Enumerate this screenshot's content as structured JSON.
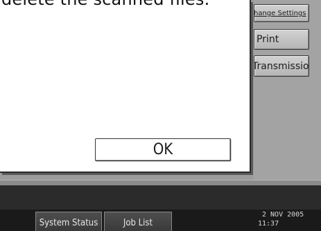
{
  "dialog": {
    "message": "delete the scanned files.",
    "ok_label": "OK"
  },
  "side_buttons": {
    "change_settings": "Change Settings",
    "print": "Print",
    "transmission": "Transmission"
  },
  "taskbar": {
    "system_status_label": "System Status",
    "job_list_label": "Job List",
    "date": "2 NOV  2005",
    "time": "11:37"
  }
}
